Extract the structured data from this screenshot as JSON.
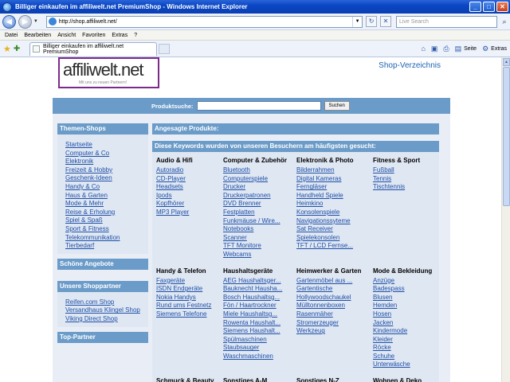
{
  "window": {
    "title": "Billiger einkaufen im affiliwelt.net PremiumShop - Windows Internet Explorer",
    "controls": [
      "_",
      "□",
      "✕"
    ]
  },
  "address": {
    "url": "http://shop.affiliwelt.net/",
    "search_placeholder": "Live Search"
  },
  "menu": [
    "Datei",
    "Bearbeiten",
    "Ansicht",
    "Favoriten",
    "Extras",
    "?"
  ],
  "tab": {
    "label": "Billiger einkaufen im affiliwelt.net PremiumShop"
  },
  "commands": {
    "page_label": "Seite",
    "extras_label": "Extras"
  },
  "site": {
    "logo_text": "affiliwelt.net",
    "logo_slogan": "Mit uns zu neuen Partnern!",
    "shop_directory": "Shop-Verzeichnis",
    "search_label": "Produktsuche:",
    "search_button": "Suchen",
    "sidebar": {
      "themes_title": "Themen-Shops",
      "themes": [
        "Startseite",
        "Computer & Co",
        "Elektronik",
        "Freizeit & Hobby",
        "Geschenk-Ideen",
        "Handy & Co",
        "Haus & Garten",
        "Mode & Mehr",
        "Reise & Erholung",
        "Spiel & Spaß",
        "Sport & Fitness",
        "Telekommunikation",
        "Tierbedarf"
      ],
      "offers_title": "Schöne Angebote",
      "partners_title": "Unsere Shoppartner",
      "partners": [
        "Reifen.com Shop",
        "Versandhaus Klingel Shop",
        "Viking Direct Shop"
      ],
      "top_title": "Top-Partner"
    },
    "main": {
      "products_title": "Angesagte Produkte:",
      "keywords_title": "Diese Keywords wurden von unseren Besuchern am häufigsten gesucht:",
      "categories": [
        {
          "title": "Audio & Hifi",
          "items": [
            "Autoradio",
            "CD-Player",
            "Headsets",
            "Ipods",
            "Kopfhörer",
            "MP3 Player"
          ]
        },
        {
          "title": "Computer & Zubehör",
          "items": [
            "Bluetooth",
            "Computerspiele",
            "Drucker",
            "Druckerpatronen",
            "DVD Brenner",
            "Festplatten",
            "Funkmäuse / Wire...",
            "Notebooks",
            "Scanner",
            "TFT Monitore",
            "Webcams"
          ]
        },
        {
          "title": "Elektronik & Photo",
          "items": [
            "Bilderrahmen",
            "Digital Kameras",
            "Ferngläser",
            "Handheld Spiele",
            "Heimkino",
            "Konsolenspiele",
            "Navigationssyteme",
            "Sat Receiver",
            "Spielekonsolen",
            "TFT / LCD Fernse..."
          ]
        },
        {
          "title": "Fitness & Sport",
          "items": [
            "Fußball",
            "Tennis",
            "Tischtennis"
          ]
        },
        {
          "title": "Handy & Telefon",
          "items": [
            "Faxgeräte",
            "ISDN Endgeräte",
            "Nokia Handys",
            "Rund ums Festnetz",
            "Siemens Telefone"
          ]
        },
        {
          "title": "Haushaltsgeräte",
          "items": [
            "AEG Haushaltsger...",
            "Bauknecht Hausha...",
            "Bosch Haushaltsg...",
            "Fön / Haartrockner",
            "Miele Haushaltsg...",
            "Rowenta Haushalt...",
            "Siemens Haushalt...",
            "Spülmaschinen",
            "Staubsauger",
            "Waschmaschinen"
          ]
        },
        {
          "title": "Heimwerker & Garten",
          "items": [
            "Gartenmöbel aus ...",
            "Gartentische",
            "Hollywoodschaukel",
            "Mülltonnenboxen",
            "Rasenmäher",
            "Stromerzeuger",
            "Werkzeug"
          ]
        },
        {
          "title": "Mode & Bekleidung",
          "items": [
            "Anzüge",
            "Badespass",
            "Blusen",
            "Hemden",
            "Hosen",
            "Jacken",
            "Kindermode",
            "Kleider",
            "Röcke",
            "Schuhe",
            "Unterwäsche"
          ]
        },
        {
          "title": "Schmuck & Beauty",
          "items": []
        },
        {
          "title": "Sonstiges A-M",
          "items": []
        },
        {
          "title": "Sonstiges N-Z",
          "items": []
        },
        {
          "title": "Wohnen & Deko",
          "items": []
        }
      ]
    }
  }
}
